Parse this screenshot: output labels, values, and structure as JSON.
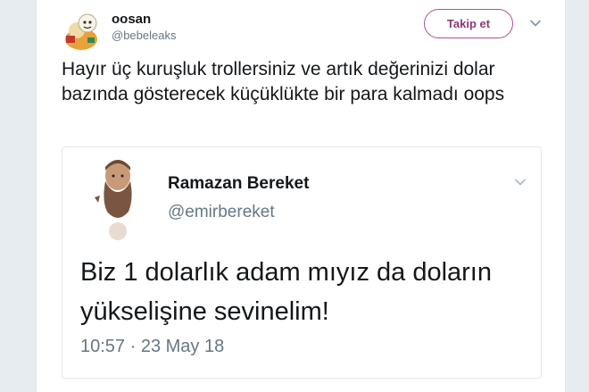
{
  "tweet": {
    "author": {
      "name": "oosan",
      "handle": "@bebeleaks",
      "avatar_icon": "cartoon-avatar-icon"
    },
    "follow_label": "Takip et",
    "text": "Hayır üç kuruşluk trollersiniz ve artık değerinizi dolar bazında gösterecek küçüklükte bir para kalmadı oops",
    "more_icon": "chevron-down-icon"
  },
  "quoted": {
    "author": {
      "name": "Ramazan Bereket",
      "handle": "@emirbereket",
      "avatar_icon": "bearded-man-avatar-icon"
    },
    "text": "Biz 1 dolarlık adam mıyız da doların yükselişine sevinelim!",
    "timestamp": "10:57 · 23 May 18",
    "more_icon": "chevron-down-icon"
  },
  "colors": {
    "follow_border": "#b04e8f",
    "follow_text": "#8e3a73",
    "secondary_text": "#657786",
    "primary_text": "#14171a"
  }
}
